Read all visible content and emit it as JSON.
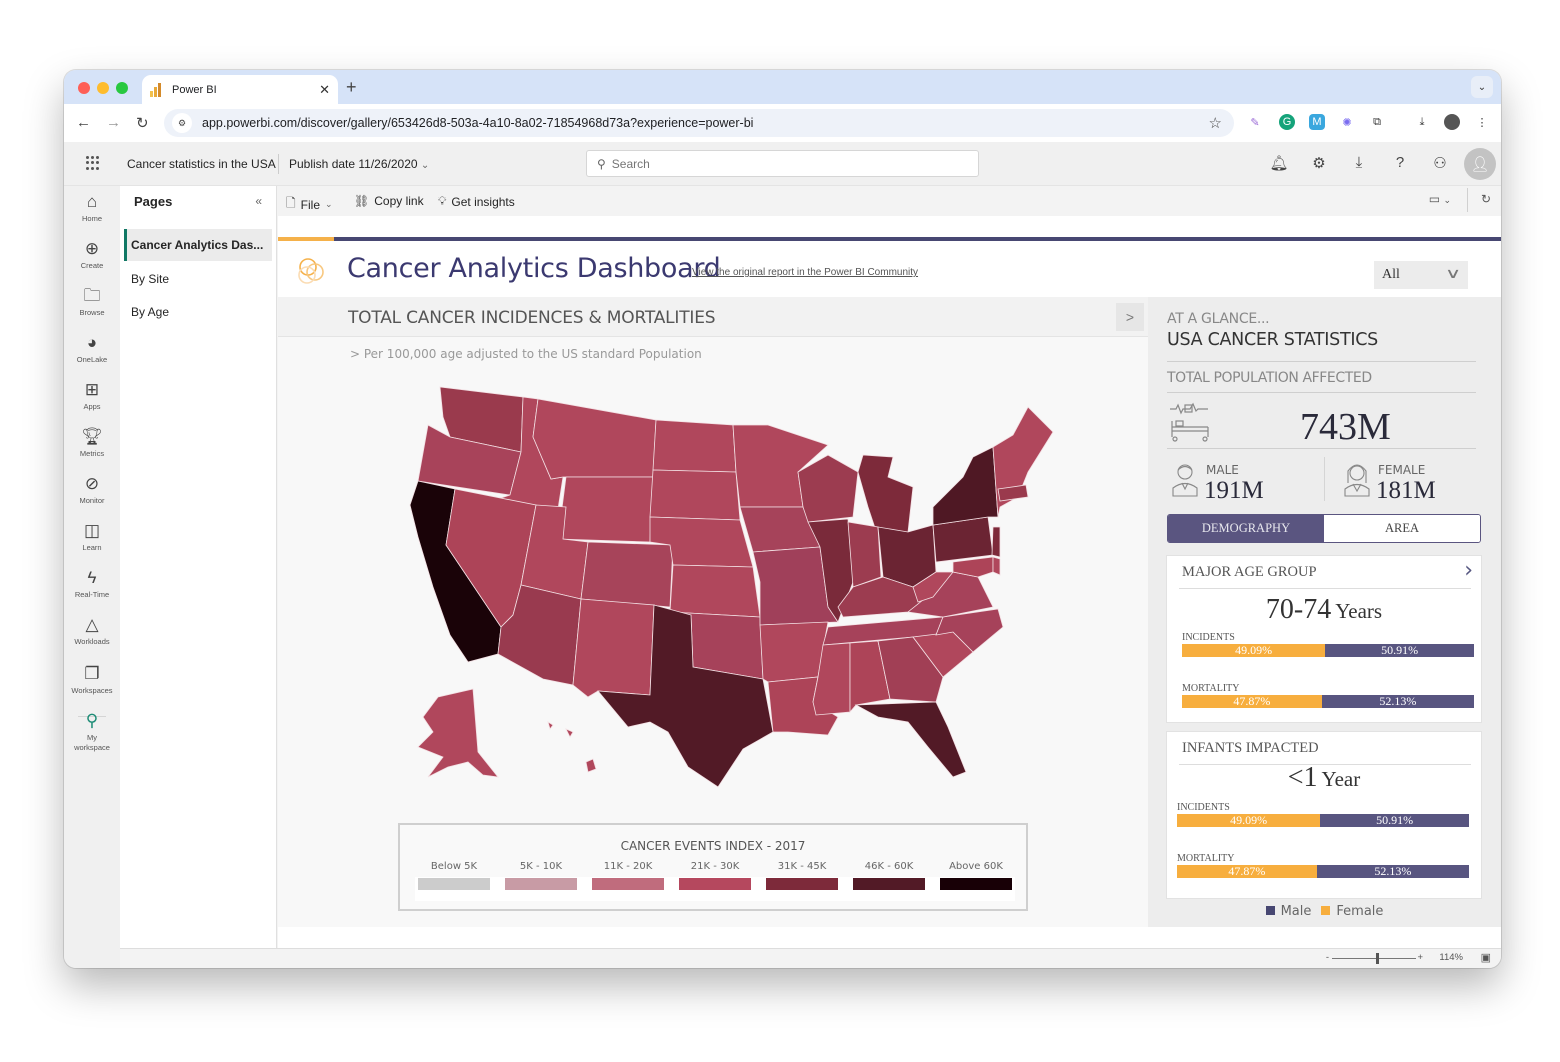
{
  "browser": {
    "tab_title": "Power BI",
    "url": "app.powerbi.com/discover/gallery/653426d8-503a-4a10-8a02-71854968d73a?experience=power-bi"
  },
  "header": {
    "report_name": "Cancer statistics in the USA",
    "publish_date": "Publish date 11/26/2020",
    "search_placeholder": "Search"
  },
  "rail": [
    {
      "label": "Home",
      "icon": "home-icon"
    },
    {
      "label": "Create",
      "icon": "plus-circle-icon"
    },
    {
      "label": "Browse",
      "icon": "folder-icon"
    },
    {
      "label": "OneLake",
      "icon": "onelake-icon"
    },
    {
      "label": "Apps",
      "icon": "apps-icon"
    },
    {
      "label": "Metrics",
      "icon": "trophy-icon"
    },
    {
      "label": "Monitor",
      "icon": "monitor-icon"
    },
    {
      "label": "Learn",
      "icon": "book-icon"
    },
    {
      "label": "Real-Time",
      "icon": "lightning-icon"
    },
    {
      "label": "Workloads",
      "icon": "shapes-icon"
    },
    {
      "label": "Workspaces",
      "icon": "workspaces-icon"
    },
    {
      "label": "My workspace",
      "icon": "person-icon"
    }
  ],
  "pages": {
    "title": "Pages",
    "items": [
      {
        "label": "Cancer Analytics Das...",
        "active": true
      },
      {
        "label": "By Site",
        "active": false
      },
      {
        "label": "By Age",
        "active": false
      }
    ]
  },
  "toolbar": {
    "file": "File",
    "copy_link": "Copy link",
    "get_insights": "Get insights"
  },
  "report": {
    "title": "Cancer Analytics Dashboard",
    "link": "View the original report in the Power BI Community",
    "slicer_value": "All",
    "map_panel": {
      "title": "TOTAL CANCER INCIDENCES & MORTALITIES",
      "subtitle": "> Per 100,000 age adjusted to the US standard Population"
    },
    "legend": {
      "title": "CANCER EVENTS INDEX - 2017",
      "bins": [
        {
          "label": "Below 5K",
          "color": "#cccccc"
        },
        {
          "label": "5K - 10K",
          "color": "#c89ba5"
        },
        {
          "label": "11K - 20K",
          "color": "#c06c7d"
        },
        {
          "label": "21K - 30K",
          "color": "#b5485e"
        },
        {
          "label": "31K - 45K",
          "color": "#7d2a3a"
        },
        {
          "label": "46K - 60K",
          "color": "#521a26"
        },
        {
          "label": "Above 60K",
          "color": "#180006"
        }
      ]
    },
    "glance": {
      "kicker": "AT A GLANCE...",
      "title": "USA CANCER STATISTICS",
      "total_label": "TOTAL POPULATION AFFECTED",
      "total_value": "743M",
      "male_label": "MALE",
      "male_value": "191M",
      "female_label": "FEMALE",
      "female_value": "181M",
      "toggle": [
        "DEMOGRAPHY",
        "AREA"
      ],
      "toggle_selected": "DEMOGRAPHY"
    },
    "age_card": {
      "title": "MAJOR AGE GROUP",
      "value": "70-74",
      "unit": "Years",
      "incidents_label": "INCIDENTS",
      "incidents_female": 49.09,
      "incidents_female_label": "49.09%",
      "incidents_male_label": "50.91%",
      "mortality_label": "MORTALITY",
      "mortality_female": 47.87,
      "mortality_female_label": "47.87%",
      "mortality_male_label": "52.13%"
    },
    "infant_card": {
      "title": "INFANTS IMPACTED",
      "value": "<1",
      "unit": "Year",
      "incidents_label": "INCIDENTS",
      "incidents_female": 49.09,
      "incidents_female_label": "49.09%",
      "incidents_male_label": "50.91%",
      "mortality_label": "MORTALITY",
      "mortality_female": 47.87,
      "mortality_female_label": "47.87%",
      "mortality_male_label": "52.13%"
    },
    "gender_legend": [
      {
        "label": "Male",
        "color": "#474772"
      },
      {
        "label": "Female",
        "color": "#f7ae3e"
      }
    ]
  },
  "status": {
    "zoom": "114%",
    "zoom_minus": "-",
    "zoom_plus": "+"
  },
  "colors": {
    "accent_purple": "#474772",
    "accent_orange": "#f5b14a",
    "map_default": "#b0475c"
  }
}
